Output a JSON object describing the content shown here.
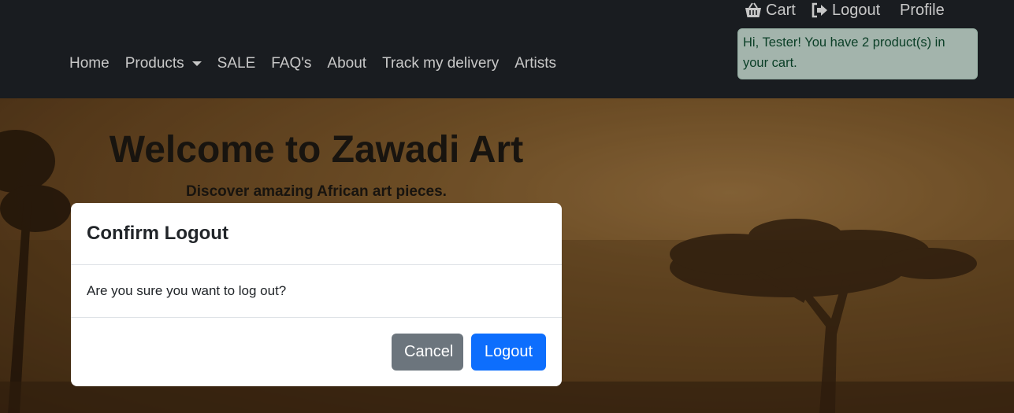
{
  "topbar": {
    "cart_label": "Cart",
    "logout_label": "Logout",
    "profile_label": "Profile"
  },
  "greeting": "Hi, Tester! You have 2 product(s) in your cart.",
  "nav": {
    "items": [
      "Home",
      "Products",
      "SALE",
      "FAQ's",
      "About",
      "Track my delivery",
      "Artists"
    ]
  },
  "hero": {
    "title": "Welcome to Zawadi Art",
    "subtitle": "Discover amazing African art pieces."
  },
  "modal": {
    "title": "Confirm Logout",
    "body": "Are you sure you want to log out?",
    "cancel_label": "Cancel",
    "confirm_label": "Logout"
  },
  "colors": {
    "navbar": "#212529",
    "success_bg": "#d1e7dd",
    "primary": "#0d6efd",
    "secondary": "#6c757d"
  },
  "icons": {
    "cart": "basket-icon",
    "logout": "sign-out-icon",
    "products": "chevron-down-icon"
  }
}
